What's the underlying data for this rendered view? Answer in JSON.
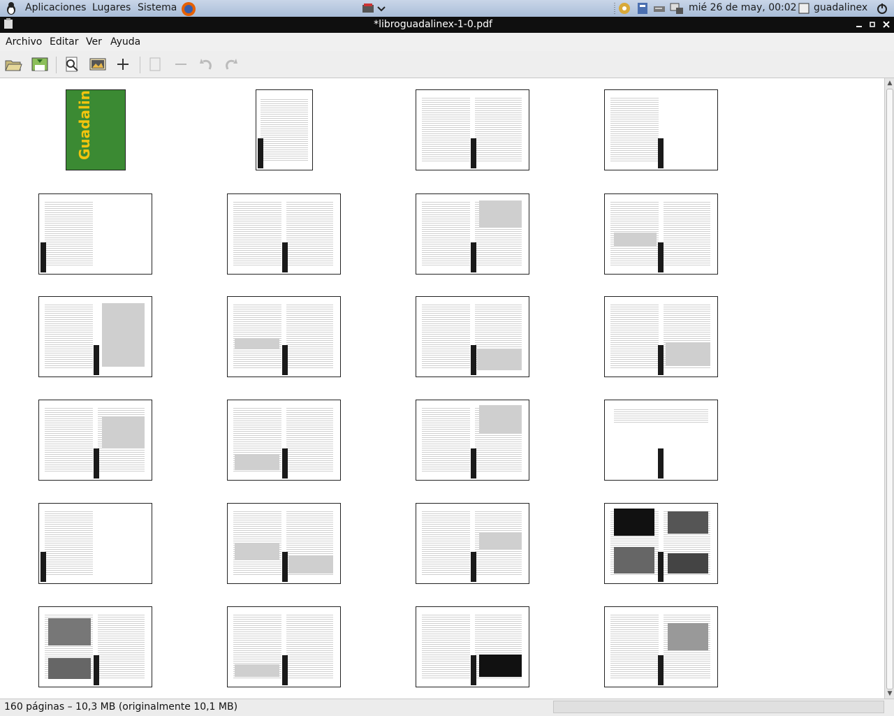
{
  "panel": {
    "menus": [
      "Aplicaciones",
      "Lugares",
      "Sistema"
    ],
    "clock": "mié 26 de may, 00:02",
    "user": "guadalinex"
  },
  "window": {
    "title": "*libroguadalinex-1-0.pdf"
  },
  "menubar": {
    "items": [
      "Archivo",
      "Editar",
      "Ver",
      "Ayuda"
    ]
  },
  "toolbar": {
    "icons": [
      "open-folder-icon",
      "save-icon",
      "preview-icon",
      "image-icon",
      "add-icon",
      "copy-icon",
      "remove-icon",
      "rotate-left-icon",
      "rotate-right-icon"
    ]
  },
  "cover": {
    "title": "Guadalinex"
  },
  "status": {
    "text": "160 páginas – 10,3 MB (originalmente 10,1 MB)"
  },
  "colors": {
    "panel": "#b7c7de",
    "titlebar": "#0f0f0f",
    "cover_green": "#3b8a33"
  }
}
